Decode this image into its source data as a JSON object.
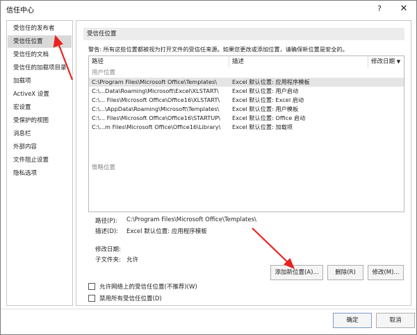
{
  "window": {
    "title": "信任中心",
    "help": "?",
    "close": "✕"
  },
  "sidebar": {
    "items": [
      {
        "label": "受信任的发布者"
      },
      {
        "label": "受信任位置"
      },
      {
        "label": "受信任的文档"
      },
      {
        "label": "受信任的加载项目录"
      },
      {
        "label": "加载项"
      },
      {
        "label": "ActiveX 设置"
      },
      {
        "label": "宏设置"
      },
      {
        "label": "受保护的视图"
      },
      {
        "label": "消息栏"
      },
      {
        "label": "外部内容"
      },
      {
        "label": "文件阻止设置"
      },
      {
        "label": "隐私选项"
      }
    ],
    "active_index": 1
  },
  "main": {
    "section_title": "受信任位置",
    "warning": "警告: 所有这些位置都被视为打开文件的受信任来源。如果您更改或添加位置，请确保新位置是安全的。",
    "columns": {
      "path": "路径",
      "desc": "描述",
      "date": "修改日期"
    },
    "group_user": "用户位置",
    "group_policy": "策略位置",
    "rows": [
      {
        "path": "C:\\Program Files\\Microsoft Office\\Templates\\",
        "desc": "Excel 默认位置: 应用程序模板"
      },
      {
        "path": "C:\\...Data\\Roaming\\Microsoft\\Excel\\XLSTART\\",
        "desc": "Excel 默认位置: 用户启动"
      },
      {
        "path": "C:\\... Files\\Microsoft Office\\Office16\\XLSTART\\",
        "desc": "Excel 默认位置: Excel 启动"
      },
      {
        "path": "C:\\...\\AppData\\Roaming\\Microsoft\\Templates\\",
        "desc": "Excel 默认位置: 用户模板"
      },
      {
        "path": "C:\\... Files\\Microsoft Office\\Office16\\STARTUP\\",
        "desc": "Excel 默认位置: Office 启动"
      },
      {
        "path": "C:\\...m Files\\Microsoft Office\\Office16\\Library\\",
        "desc": "Excel 默认位置: 加载项"
      }
    ],
    "details": {
      "path_label": "路径(P):",
      "path_value": "C:\\Program Files\\Microsoft Office\\Templates\\",
      "desc_label": "描述(D):",
      "desc_value": "Excel 默认位置: 应用程序模板",
      "date_label": "修改日期:",
      "date_value": "",
      "subfolders_label": "子文件夹:",
      "subfolders_value": "允许"
    },
    "buttons": {
      "add": "添加新位置(A)...",
      "remove": "删除(R)",
      "modify": "修改(M)..."
    },
    "checkboxes": {
      "allow_network": "允许网络上的受信任位置(不推荐)(W)",
      "disable_all": "禁用所有受信任位置(D)"
    }
  },
  "footer": {
    "ok": "确定",
    "cancel": "取消"
  },
  "colors": {
    "annotation_arrow": "#e8231f",
    "selected_row": "#e5e5e5",
    "active_sidebar": "#d9d9d9"
  }
}
